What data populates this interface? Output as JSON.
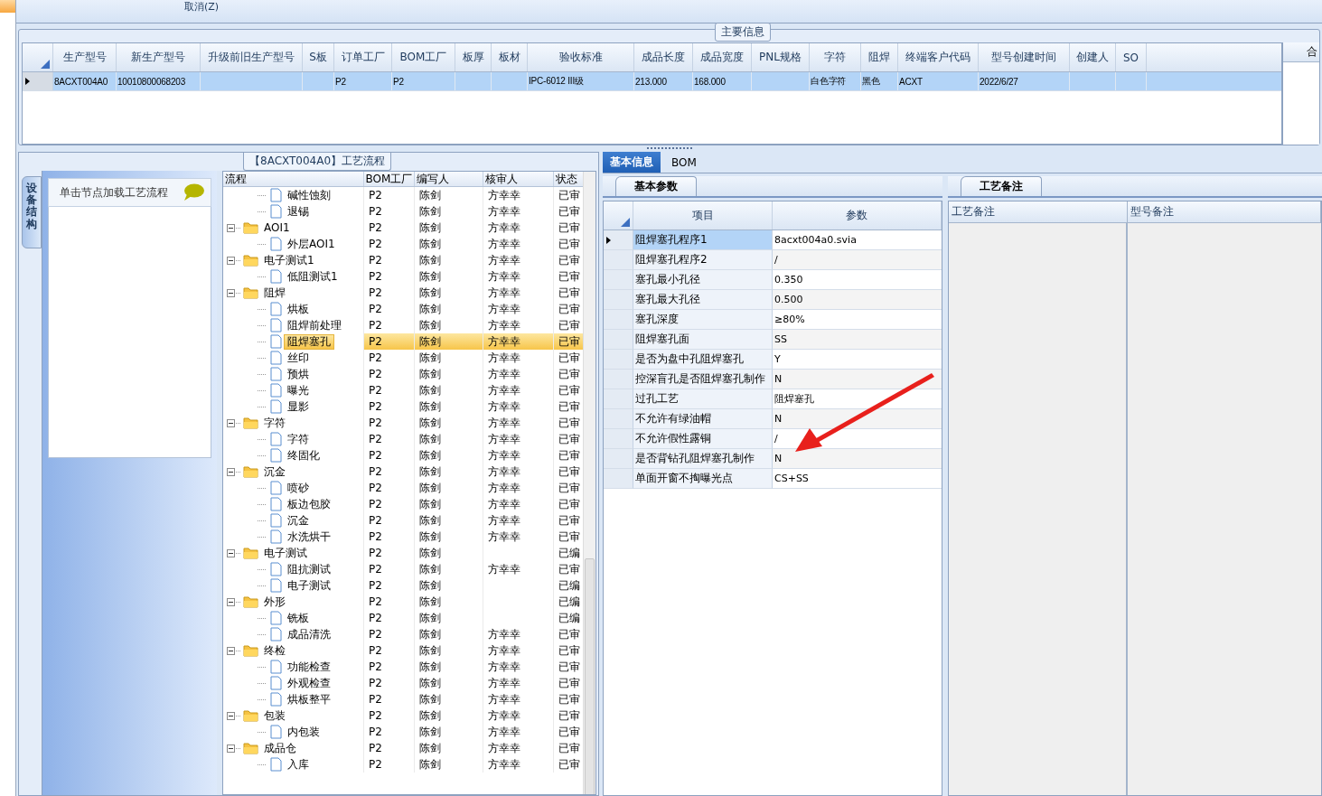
{
  "toolbar": {
    "cut_button": "取消(Z)"
  },
  "main_info": {
    "title": "主要信息",
    "columns": [
      "生产型号",
      "新生产型号",
      "升级前旧生产型号",
      "S板",
      "订单工厂",
      "BOM工厂",
      "板厚",
      "板材",
      "验收标准",
      "成品长度",
      "成品宽度",
      "PNL规格",
      "字符",
      "阻焊",
      "终端客户代码",
      "型号创建时间",
      "创建人",
      "SO"
    ],
    "rows": [
      {
        "selected": true,
        "cells": [
          "8ACXT004A0",
          "10010800068203",
          "",
          "",
          "P2",
          "P2",
          "",
          "",
          "IPC-6012 III级",
          "213.000",
          "168.000",
          "",
          "白色字符",
          "黑色",
          "ACXT",
          "2022/6/27",
          "",
          ""
        ]
      }
    ],
    "side_header": "合"
  },
  "flow_panel": {
    "title": "【8ACXT004A0】工艺流程",
    "side_tab": "设备结构",
    "hint": "单击节点加载工艺流程",
    "columns": [
      "流程",
      "BOM工厂",
      "编写人",
      "核审人",
      "状态"
    ],
    "tree": [
      {
        "children": [
          {
            "name": "碱性蚀刻",
            "bom": "P2",
            "writer": "陈剑",
            "reviewer": "方幸幸",
            "status": "已审",
            "selected": false
          },
          {
            "name": "退锡",
            "bom": "P2",
            "writer": "陈剑",
            "reviewer": "方幸幸",
            "status": "已审",
            "selected": false
          }
        ]
      },
      {
        "name": "AOI1",
        "bom": "P2",
        "writer": "陈剑",
        "reviewer": "方幸幸",
        "status": "已审",
        "selected": false,
        "expanded": true,
        "children": [
          {
            "name": "外层AOI1",
            "bom": "P2",
            "writer": "陈剑",
            "reviewer": "方幸幸",
            "status": "已审",
            "selected": false
          }
        ]
      },
      {
        "name": "电子测试1",
        "bom": "P2",
        "writer": "陈剑",
        "reviewer": "方幸幸",
        "status": "已审",
        "selected": false,
        "expanded": true,
        "children": [
          {
            "name": "低阻测试1",
            "bom": "P2",
            "writer": "陈剑",
            "reviewer": "方幸幸",
            "status": "已审",
            "selected": false
          }
        ]
      },
      {
        "name": "阻焊",
        "bom": "P2",
        "writer": "陈剑",
        "reviewer": "方幸幸",
        "status": "已审",
        "selected": false,
        "expanded": true,
        "children": [
          {
            "name": "烘板",
            "bom": "P2",
            "writer": "陈剑",
            "reviewer": "方幸幸",
            "status": "已审",
            "selected": false
          },
          {
            "name": "阻焊前处理",
            "bom": "P2",
            "writer": "陈剑",
            "reviewer": "方幸幸",
            "status": "已审",
            "selected": false
          },
          {
            "name": "阻焊塞孔",
            "bom": "P2",
            "writer": "陈剑",
            "reviewer": "方幸幸",
            "status": "已审",
            "selected": true
          },
          {
            "name": "丝印",
            "bom": "P2",
            "writer": "陈剑",
            "reviewer": "方幸幸",
            "status": "已审",
            "selected": false
          },
          {
            "name": "预烘",
            "bom": "P2",
            "writer": "陈剑",
            "reviewer": "方幸幸",
            "status": "已审",
            "selected": false
          },
          {
            "name": "曝光",
            "bom": "P2",
            "writer": "陈剑",
            "reviewer": "方幸幸",
            "status": "已审",
            "selected": false
          },
          {
            "name": "显影",
            "bom": "P2",
            "writer": "陈剑",
            "reviewer": "方幸幸",
            "status": "已审",
            "selected": false
          }
        ]
      },
      {
        "name": "字符",
        "bom": "P2",
        "writer": "陈剑",
        "reviewer": "方幸幸",
        "status": "已审",
        "selected": false,
        "expanded": true,
        "children": [
          {
            "name": "字符",
            "bom": "P2",
            "writer": "陈剑",
            "reviewer": "方幸幸",
            "status": "已审",
            "selected": false
          },
          {
            "name": "终固化",
            "bom": "P2",
            "writer": "陈剑",
            "reviewer": "方幸幸",
            "status": "已审",
            "selected": false
          }
        ]
      },
      {
        "name": "沉金",
        "bom": "P2",
        "writer": "陈剑",
        "reviewer": "方幸幸",
        "status": "已审",
        "selected": false,
        "expanded": true,
        "children": [
          {
            "name": "喷砂",
            "bom": "P2",
            "writer": "陈剑",
            "reviewer": "方幸幸",
            "status": "已审",
            "selected": false
          },
          {
            "name": "板边包胶",
            "bom": "P2",
            "writer": "陈剑",
            "reviewer": "方幸幸",
            "status": "已审",
            "selected": false
          },
          {
            "name": "沉金",
            "bom": "P2",
            "writer": "陈剑",
            "reviewer": "方幸幸",
            "status": "已审",
            "selected": false
          },
          {
            "name": "水洗烘干",
            "bom": "P2",
            "writer": "陈剑",
            "reviewer": "方幸幸",
            "status": "已审",
            "selected": false
          }
        ]
      },
      {
        "name": "电子测试",
        "bom": "P2",
        "writer": "陈剑",
        "status": "已编",
        "selected": false,
        "expanded": true,
        "children": [
          {
            "name": "阻抗测试",
            "bom": "P2",
            "writer": "陈剑",
            "reviewer": "方幸幸",
            "status": "已审",
            "selected": false
          },
          {
            "name": "电子测试",
            "bom": "P2",
            "writer": "陈剑",
            "status": "已编",
            "selected": false
          }
        ]
      },
      {
        "name": "外形",
        "bom": "P2",
        "writer": "陈剑",
        "status": "已编",
        "selected": false,
        "expanded": true,
        "children": [
          {
            "name": "铣板",
            "bom": "P2",
            "writer": "陈剑",
            "status": "已编",
            "selected": false
          },
          {
            "name": "成品清洗",
            "bom": "P2",
            "writer": "陈剑",
            "reviewer": "方幸幸",
            "status": "已审",
            "selected": false
          }
        ]
      },
      {
        "name": "终检",
        "bom": "P2",
        "writer": "陈剑",
        "reviewer": "方幸幸",
        "status": "已审",
        "selected": false,
        "expanded": true,
        "children": [
          {
            "name": "功能检查",
            "bom": "P2",
            "writer": "陈剑",
            "reviewer": "方幸幸",
            "status": "已审",
            "selected": false
          },
          {
            "name": "外观检查",
            "bom": "P2",
            "writer": "陈剑",
            "reviewer": "方幸幸",
            "status": "已审",
            "selected": false
          },
          {
            "name": "烘板整平",
            "bom": "P2",
            "writer": "陈剑",
            "reviewer": "方幸幸",
            "status": "已审",
            "selected": false
          }
        ]
      },
      {
        "name": "包装",
        "bom": "P2",
        "writer": "陈剑",
        "reviewer": "方幸幸",
        "status": "已审",
        "selected": false,
        "expanded": true,
        "children": [
          {
            "name": "内包装",
            "bom": "P2",
            "writer": "陈剑",
            "reviewer": "方幸幸",
            "status": "已审",
            "selected": false
          }
        ]
      },
      {
        "name": "成品仓",
        "bom": "P2",
        "writer": "陈剑",
        "reviewer": "方幸幸",
        "status": "已审",
        "selected": false,
        "expanded": true,
        "children": [
          {
            "name": "入库",
            "bom": "P2",
            "writer": "陈剑",
            "reviewer": "方幸幸",
            "status": "已审",
            "selected": false
          }
        ]
      }
    ]
  },
  "detail_tabs": [
    {
      "label": "基本信息",
      "selected": true
    },
    {
      "label": "BOM",
      "selected": false
    }
  ],
  "params_panel": {
    "tab": "基本参数",
    "columns": [
      "项目",
      "参数"
    ],
    "rows": [
      {
        "item": "阻焊塞孔程序1",
        "value": "8acxt004a0.svia",
        "selected": true
      },
      {
        "item": "阻焊塞孔程序2",
        "value": "/",
        "selected": false
      },
      {
        "item": "塞孔最小孔径",
        "value": "0.350",
        "selected": false
      },
      {
        "item": "塞孔最大孔径",
        "value": "0.500",
        "selected": false
      },
      {
        "item": "塞孔深度",
        "value": "≥80%",
        "selected": false
      },
      {
        "item": "阻焊塞孔面",
        "value": "SS",
        "selected": false
      },
      {
        "item": "是否为盘中孔阻焊塞孔",
        "value": "Y",
        "selected": false
      },
      {
        "item": "控深盲孔是否阻焊塞孔制作",
        "value": "N",
        "selected": false
      },
      {
        "item": "过孔工艺",
        "value": "阻焊塞孔",
        "selected": false
      },
      {
        "item": "不允许有绿油帽",
        "value": "N",
        "selected": false
      },
      {
        "item": "不允许假性露铜",
        "value": "/",
        "selected": false
      },
      {
        "item": "是否背钻孔阻焊塞孔制作",
        "value": "N",
        "selected": false
      },
      {
        "item": "单面开窗不掏曝光点",
        "value": "CS+SS",
        "selected": false
      }
    ]
  },
  "notes_panel": {
    "tab": "工艺备注",
    "columns": [
      "工艺备注",
      "型号备注"
    ]
  }
}
